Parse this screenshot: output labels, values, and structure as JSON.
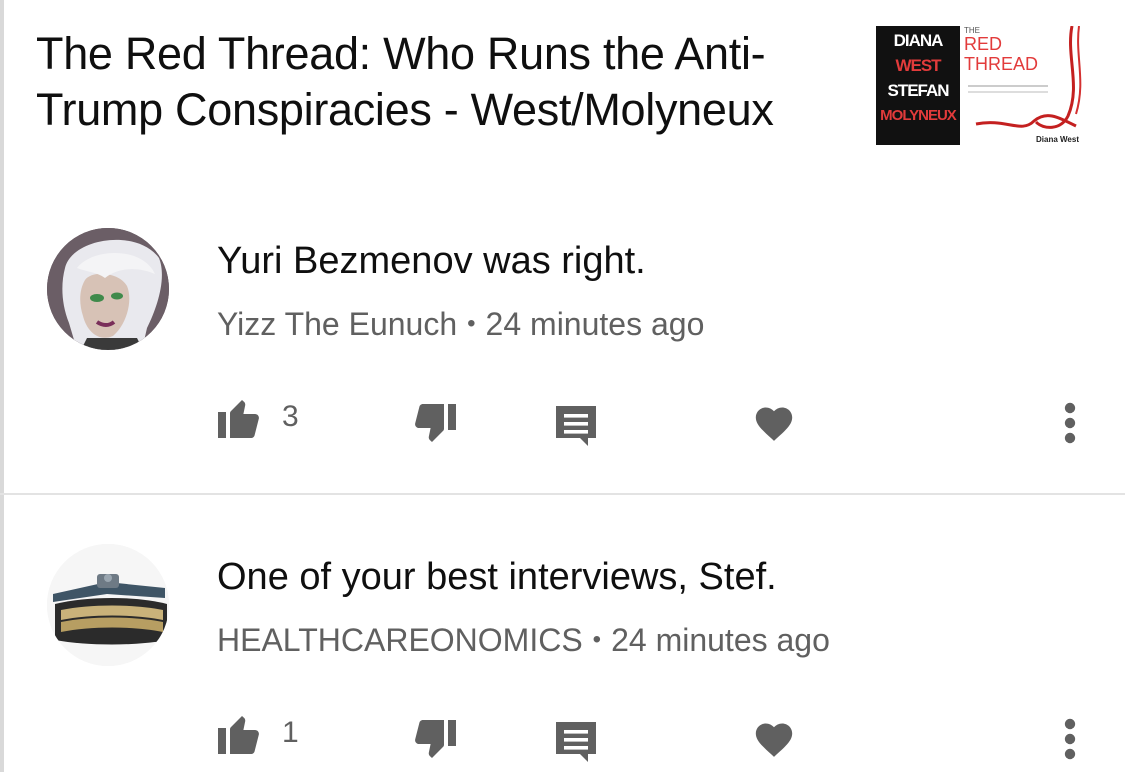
{
  "video": {
    "title": "The Red Thread: Who Runs the Anti-Trump Conspiracies - West/Molyneux",
    "thumbnail": {
      "name_diana": "DIANA",
      "name_west": "WEST",
      "name_stefan": "STEFAN",
      "name_molyneux": "MOLYNEUX",
      "small_the": "THE",
      "red": "RED",
      "thread": "THREAD",
      "author": "Diana West"
    }
  },
  "comments": [
    {
      "text": "Yuri Bezmenov was right.",
      "author": "Yizz The Eunuch",
      "separator": "•",
      "time": "24 minutes ago",
      "likes": "3"
    },
    {
      "text": "One of your best interviews, Stef.",
      "author": "HEALTHCAREONOMICS",
      "separator": "•",
      "time": "24 minutes ago",
      "likes": "1"
    }
  ],
  "icons": {
    "like": "thumb-up-icon",
    "dislike": "thumb-down-icon",
    "reply": "comment-reply-icon",
    "heart": "heart-icon",
    "more": "more-vertical-icon"
  },
  "colors": {
    "text": "#0f0f0f",
    "meta": "#606060",
    "icon": "#606060",
    "thumb_red": "#e23b3b"
  }
}
